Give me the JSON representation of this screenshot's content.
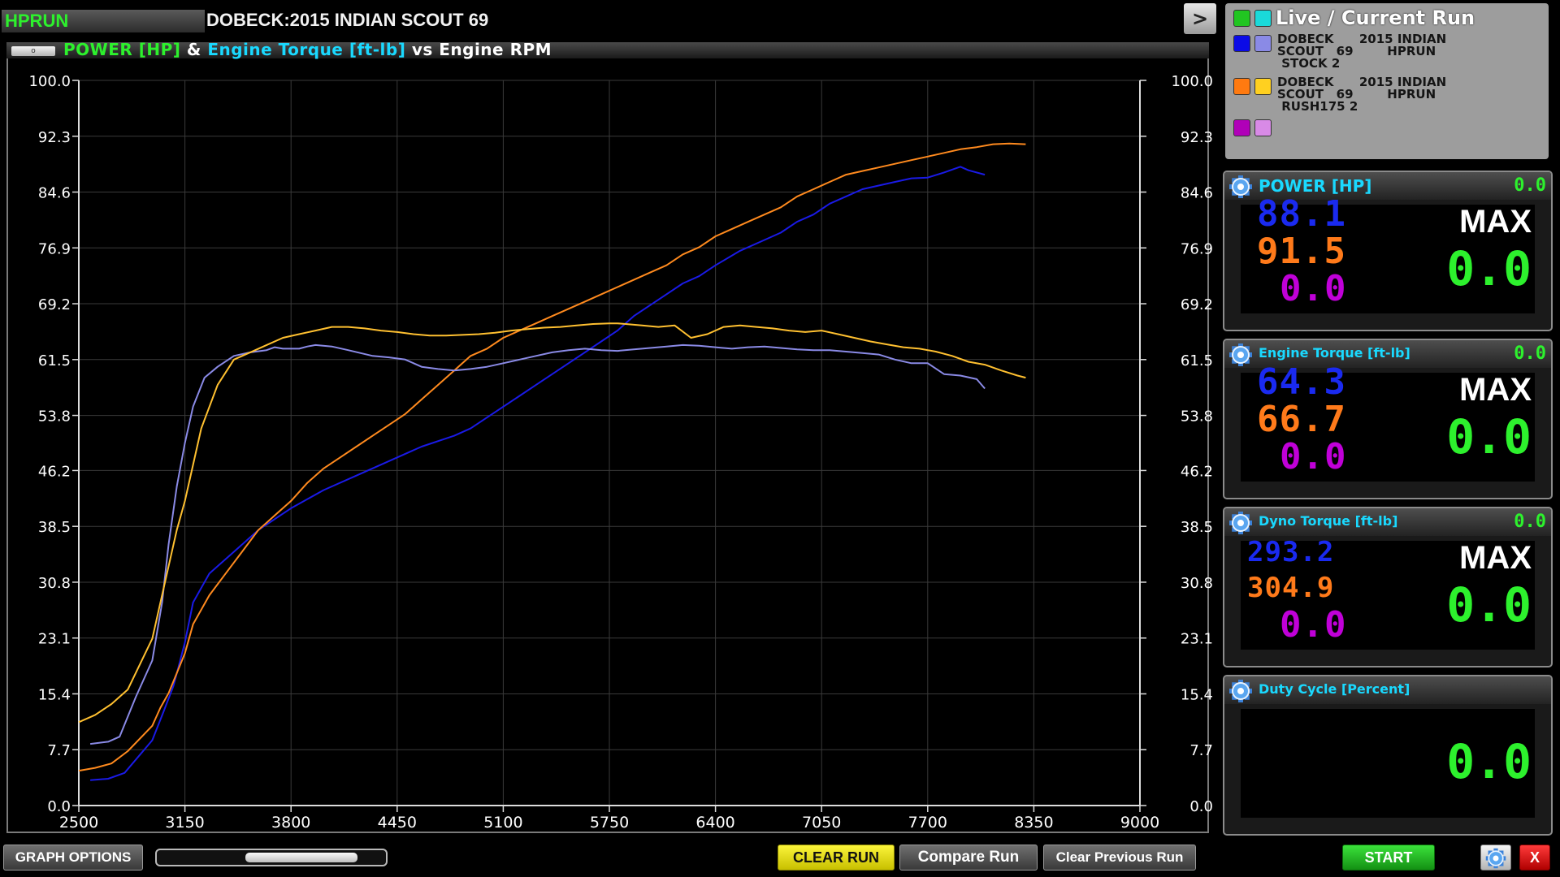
{
  "app": {
    "brand": "HPRUN",
    "title": "DOBECK:2015 INDIAN SCOUT 69",
    "next_button": ">"
  },
  "chart": {
    "handle_label": "o",
    "title_parts": {
      "power": "POWER [HP]",
      "amp": "&",
      "torque": "Engine Torque [ft-lb]",
      "rest": "vs Engine RPM"
    },
    "colors": {
      "power": "#2df12d",
      "torque": "#1ad9ff",
      "rest": "#ffffff"
    }
  },
  "chart_data": {
    "type": "line",
    "title": "POWER [HP] & Engine Torque [ft-lb] vs Engine RPM",
    "xlim": [
      2500,
      9000
    ],
    "ylim": [
      0,
      100
    ],
    "x_ticks": [
      "2500",
      "3150",
      "3800",
      "4450",
      "5100",
      "5750",
      "6400",
      "7050",
      "7700",
      "8350",
      "9000"
    ],
    "y_ticks": [
      "0.0",
      "7.7",
      "15.4",
      "23.1",
      "30.8",
      "38.5",
      "46.2",
      "53.8",
      "61.5",
      "69.2",
      "76.9",
      "84.6",
      "92.3",
      "100.0"
    ],
    "y_ticks_right": [
      "0.0",
      "7.7",
      "15.4",
      "23.1",
      "30.8",
      "38.5",
      "46.2",
      "53.8",
      "61.5",
      "69.2",
      "76.9",
      "84.6",
      "92.3",
      "100.0"
    ],
    "grid": true,
    "series": [
      {
        "color": "#1a1ae6",
        "x": [
          2570,
          2680,
          2780,
          2950,
          3020,
          3080,
          3150,
          3200,
          3300,
          3450,
          3600,
          3800,
          4000,
          4200,
          4400,
          4600,
          4800,
          4900,
          5000,
          5200,
          5300,
          5400,
          5500,
          5600,
          5700,
          5800,
          5900,
          6000,
          6100,
          6200,
          6300,
          6400,
          6550,
          6700,
          6800,
          6900,
          7000,
          7100,
          7200,
          7300,
          7400,
          7500,
          7600,
          7700,
          7800,
          7900,
          7950,
          8050
        ],
        "y": [
          3.5,
          3.7,
          4.5,
          9.0,
          13.0,
          16.5,
          22.5,
          28.0,
          32.0,
          35.0,
          38.0,
          41.0,
          43.5,
          45.5,
          47.5,
          49.5,
          51.0,
          52.0,
          53.5,
          56.5,
          58.0,
          59.5,
          61.0,
          62.5,
          64.0,
          65.5,
          67.5,
          69.0,
          70.5,
          72.0,
          73.0,
          74.5,
          76.5,
          78.0,
          79.0,
          80.5,
          81.5,
          83.0,
          84.0,
          85.0,
          85.5,
          86.0,
          86.5,
          86.6,
          87.3,
          88.1,
          87.6,
          87.0
        ]
      },
      {
        "color": "#ff8a1e",
        "x": [
          2500,
          2600,
          2700,
          2800,
          2950,
          3000,
          3050,
          3150,
          3200,
          3300,
          3400,
          3500,
          3600,
          3700,
          3800,
          3900,
          4000,
          4100,
          4200,
          4300,
          4400,
          4500,
          4600,
          4700,
          4800,
          4900,
          5000,
          5100,
          5200,
          5300,
          5400,
          5500,
          5600,
          5700,
          5800,
          5900,
          6000,
          6100,
          6200,
          6300,
          6400,
          6500,
          6600,
          6700,
          6800,
          6900,
          7000,
          7100,
          7200,
          7300,
          7400,
          7500,
          7600,
          7700,
          7800,
          7900,
          8000,
          8100,
          8200,
          8300
        ],
        "y": [
          4.8,
          5.2,
          5.8,
          7.5,
          11.0,
          13.5,
          15.5,
          21.0,
          25.0,
          29.0,
          32.0,
          35.0,
          38.0,
          40.0,
          42.0,
          44.5,
          46.5,
          48.0,
          49.5,
          51.0,
          52.5,
          54.0,
          56.0,
          58.0,
          60.0,
          62.0,
          63.0,
          64.5,
          65.5,
          66.5,
          67.5,
          68.5,
          69.5,
          70.5,
          71.5,
          72.5,
          73.5,
          74.5,
          76.0,
          77.0,
          78.5,
          79.5,
          80.5,
          81.5,
          82.5,
          84.0,
          85.0,
          86.0,
          87.0,
          87.5,
          88.0,
          88.5,
          89.0,
          89.5,
          90.0,
          90.5,
          90.8,
          91.2,
          91.3,
          91.2
        ]
      },
      {
        "color": "#8a8ae6",
        "x": [
          2570,
          2680,
          2750,
          2850,
          2950,
          3010,
          3050,
          3100,
          3150,
          3200,
          3270,
          3350,
          3450,
          3550,
          3650,
          3700,
          3750,
          3850,
          3900,
          3950,
          4050,
          4150,
          4300,
          4400,
          4500,
          4600,
          4700,
          4800,
          4900,
          5000,
          5100,
          5200,
          5300,
          5400,
          5500,
          5600,
          5700,
          5800,
          5900,
          6000,
          6100,
          6200,
          6300,
          6400,
          6500,
          6600,
          6700,
          6800,
          6900,
          7000,
          7100,
          7200,
          7300,
          7400,
          7500,
          7600,
          7700,
          7800,
          7900,
          8000,
          8050
        ],
        "y": [
          8.5,
          8.8,
          9.5,
          15.0,
          20.0,
          28.0,
          36.0,
          44.0,
          50.0,
          55.0,
          59.0,
          60.5,
          62.0,
          62.5,
          62.8,
          63.2,
          63.0,
          63.0,
          63.3,
          63.5,
          63.3,
          62.8,
          62.0,
          61.8,
          61.5,
          60.5,
          60.2,
          60.0,
          60.2,
          60.5,
          61.0,
          61.5,
          62.0,
          62.5,
          62.8,
          63.0,
          62.8,
          62.7,
          62.9,
          63.1,
          63.3,
          63.5,
          63.4,
          63.2,
          63.0,
          63.2,
          63.3,
          63.1,
          62.9,
          62.8,
          62.8,
          62.6,
          62.4,
          62.2,
          61.5,
          61.0,
          61.0,
          59.5,
          59.3,
          58.8,
          57.5
        ]
      },
      {
        "color": "#ffc030",
        "x": [
          2500,
          2600,
          2700,
          2800,
          2950,
          3050,
          3100,
          3150,
          3250,
          3350,
          3450,
          3550,
          3650,
          3750,
          3850,
          3950,
          4050,
          4150,
          4250,
          4350,
          4450,
          4550,
          4650,
          4750,
          4850,
          4950,
          5050,
          5150,
          5250,
          5350,
          5450,
          5550,
          5650,
          5750,
          5800,
          5850,
          5950,
          6050,
          6150,
          6250,
          6350,
          6450,
          6550,
          6650,
          6750,
          6850,
          6950,
          7050,
          7150,
          7250,
          7350,
          7450,
          7550,
          7650,
          7750,
          7850,
          7950,
          8050,
          8150,
          8250,
          8300
        ],
        "y": [
          11.5,
          12.5,
          14.0,
          16.0,
          23.0,
          33.0,
          38.0,
          42.0,
          52.0,
          58.0,
          61.5,
          62.5,
          63.5,
          64.5,
          65.0,
          65.5,
          66.0,
          66.0,
          65.8,
          65.5,
          65.3,
          65.0,
          64.8,
          64.8,
          64.9,
          65.0,
          65.2,
          65.5,
          65.7,
          65.9,
          66.0,
          66.2,
          66.4,
          66.5,
          66.5,
          66.4,
          66.2,
          66.0,
          66.2,
          64.5,
          65.0,
          66.0,
          66.2,
          66.0,
          65.8,
          65.5,
          65.3,
          65.5,
          65.0,
          64.5,
          64.0,
          63.6,
          63.2,
          63.0,
          62.6,
          62.0,
          61.2,
          60.8,
          60.0,
          59.3,
          59.0
        ]
      }
    ]
  },
  "legend": {
    "title": "Live / Current Run",
    "rows": [
      {
        "colors": [
          "#21c521",
          "#1ad9d9"
        ],
        "lines": []
      },
      {
        "colors": [
          "#0b0be6",
          "#8a8ae6"
        ],
        "lines": [
          "DOBECK      2015 INDIAN",
          "SCOUT   69        HPRUN",
          " STOCK 2"
        ]
      },
      {
        "colors": [
          "#ff7a10",
          "#ffd020"
        ],
        "lines": [
          "DOBECK      2015 INDIAN",
          "SCOUT   69        HPRUN",
          " RUSH175 2"
        ]
      },
      {
        "colors": [
          "#b000b8",
          "#d88ae6"
        ],
        "lines": []
      }
    ]
  },
  "gauges": [
    {
      "label": "POWER [HP]",
      "header_value": "0.0",
      "values": [
        "88.1",
        "91.5",
        "0.0"
      ],
      "max_label": "MAX",
      "max_value": "0.0"
    },
    {
      "label": "Engine Torque [ft-lb]",
      "header_value": "0.0",
      "values": [
        "64.3",
        "66.7",
        "0.0"
      ],
      "max_label": "MAX",
      "max_value": "0.0"
    },
    {
      "label": "Dyno Torque [ft-lb]",
      "header_value": "0.0",
      "values": [
        "293.2",
        "304.9",
        "0.0"
      ],
      "max_label": "MAX",
      "max_value": "0.0"
    },
    {
      "label": "Duty Cycle [Percent]",
      "value": "0.0"
    }
  ],
  "gauge_value_colors": [
    "#1a2af0",
    "#ff7a1a",
    "#c000d8"
  ],
  "bottom": {
    "graph_options": "GRAPH OPTIONS",
    "clear_run": "CLEAR RUN",
    "compare_run": "Compare Run",
    "clear_previous_run": "Clear Previous Run",
    "start": "START",
    "close": "X"
  }
}
